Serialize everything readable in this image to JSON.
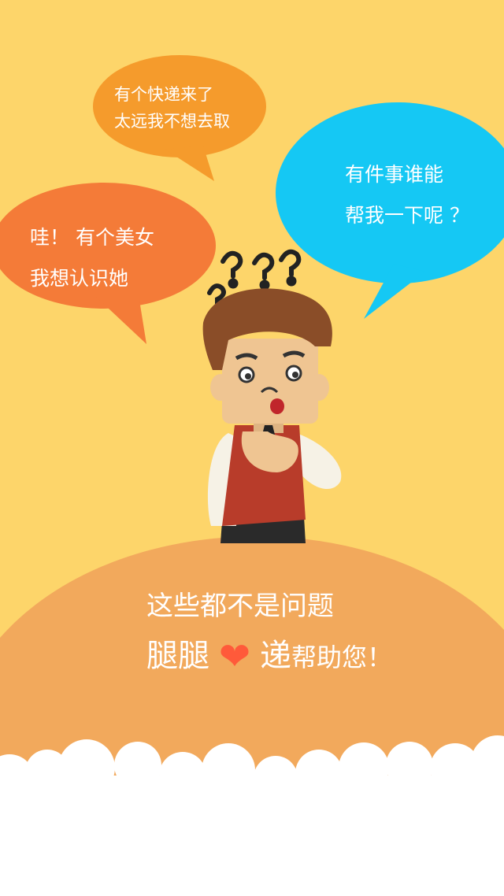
{
  "bubbles": {
    "courier": {
      "line1": "有个快递来了",
      "line2": "太远我不想去取"
    },
    "help": {
      "line1": "有件事谁能",
      "line2": "帮我一下呢 ？"
    },
    "girl": {
      "line1": "哇！  有个美女",
      "line2": "我想认识她"
    }
  },
  "slogan": {
    "line1": "这些都不是问题",
    "brand_part1": "腿腿",
    "heart": "❤",
    "brand_part2": "递",
    "tagline": "帮助您！"
  },
  "colors": {
    "background": "#fdd56a",
    "hill": "#f2a95c",
    "bubble_orange": "#f59b2c",
    "bubble_red": "#f47b38",
    "bubble_blue": "#15c8f4",
    "heart": "#ff5a3a"
  },
  "icons": [
    "question-marks-icon",
    "heart-icon",
    "cloud-border"
  ]
}
